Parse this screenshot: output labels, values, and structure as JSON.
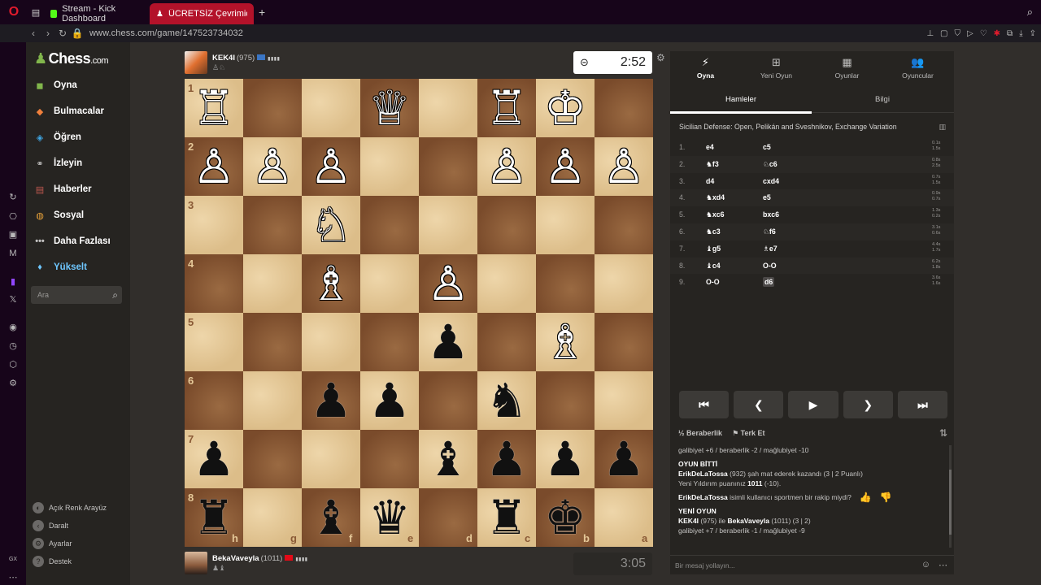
{
  "browser": {
    "tabs": [
      {
        "title": "Stream - Kick Dashboard",
        "favicon_color": "#53fc18"
      },
      {
        "title": "ÜCRETSİZ Çevrimiçi Satra",
        "favicon_color": "#81b64c"
      }
    ],
    "url": "www.chess.com/game/147523734032"
  },
  "sidebar": {
    "brand": "Chess",
    "brand_suffix": ".com",
    "items": [
      {
        "label": "Oyna",
        "icon": "play-icon",
        "color": "#81b64c"
      },
      {
        "label": "Bulmacalar",
        "icon": "puzzle-icon",
        "color": "#f0803c"
      },
      {
        "label": "Öğren",
        "icon": "learn-icon",
        "color": "#3fa6e3"
      },
      {
        "label": "İzleyin",
        "icon": "binoculars-icon",
        "color": "#c4c3c2"
      },
      {
        "label": "Haberler",
        "icon": "news-icon",
        "color": "#c0584f"
      },
      {
        "label": "Sosyal",
        "icon": "social-icon",
        "color": "#e8a23a"
      },
      {
        "label": "Daha Fazlası",
        "icon": "more-icon",
        "color": "#c4c3c2"
      },
      {
        "label": "Yükselt",
        "icon": "diamond-icon",
        "color": "#6ec7ff"
      }
    ],
    "search_placeholder": "Ara",
    "bottom": [
      {
        "label": "Açık Renk Arayüz",
        "icon": "theme-icon"
      },
      {
        "label": "Daralt",
        "icon": "collapse-icon"
      },
      {
        "label": "Ayarlar",
        "icon": "settings-icon"
      },
      {
        "label": "Destek",
        "icon": "help-icon"
      }
    ]
  },
  "players": {
    "top": {
      "name": "KEK4I",
      "rating": "(975)",
      "clock": "2:52",
      "flag_color": "#3a75c4"
    },
    "bottom": {
      "name": "BekaVaveyla",
      "rating": "(1011)",
      "clock": "3:05",
      "flag_color": "#e30a17"
    }
  },
  "board": {
    "files_bottom": [
      "h",
      "g",
      "f",
      "e",
      "d",
      "c",
      "b",
      "a"
    ],
    "ranks_left": [
      "1",
      "2",
      "3",
      "4",
      "5",
      "6",
      "7",
      "8"
    ],
    "pieces": [
      {
        "sq": "b1",
        "p": "♔",
        "c": "w"
      },
      {
        "sq": "c1",
        "p": "♖",
        "c": "w"
      },
      {
        "sq": "e1",
        "p": "♕",
        "c": "w"
      },
      {
        "sq": "h1",
        "p": "♖",
        "c": "w"
      },
      {
        "sq": "a2",
        "p": "♙",
        "c": "w"
      },
      {
        "sq": "b2",
        "p": "♙",
        "c": "w"
      },
      {
        "sq": "c2",
        "p": "♙",
        "c": "w"
      },
      {
        "sq": "f2",
        "p": "♙",
        "c": "w"
      },
      {
        "sq": "g2",
        "p": "♙",
        "c": "w"
      },
      {
        "sq": "h2",
        "p": "♙",
        "c": "w"
      },
      {
        "sq": "f3",
        "p": "♘",
        "c": "w"
      },
      {
        "sq": "d4",
        "p": "♙",
        "c": "w"
      },
      {
        "sq": "f4",
        "p": "♗",
        "c": "w"
      },
      {
        "sq": "b5",
        "p": "♗",
        "c": "w"
      },
      {
        "sq": "d5",
        "p": "♟",
        "c": "b"
      },
      {
        "sq": "c6",
        "p": "♞",
        "c": "b"
      },
      {
        "sq": "e6",
        "p": "♟",
        "c": "b"
      },
      {
        "sq": "f6",
        "p": "♟",
        "c": "b"
      },
      {
        "sq": "a7",
        "p": "♟",
        "c": "b"
      },
      {
        "sq": "b7",
        "p": "♟",
        "c": "b"
      },
      {
        "sq": "c7",
        "p": "♟",
        "c": "b"
      },
      {
        "sq": "d7",
        "p": "♝",
        "c": "b"
      },
      {
        "sq": "h7",
        "p": "♟",
        "c": "b"
      },
      {
        "sq": "b8",
        "p": "♚",
        "c": "b"
      },
      {
        "sq": "c8",
        "p": "♜",
        "c": "b"
      },
      {
        "sq": "e8",
        "p": "♛",
        "c": "b"
      },
      {
        "sq": "f8",
        "p": "♝",
        "c": "b"
      },
      {
        "sq": "h8",
        "p": "♜",
        "c": "b"
      }
    ]
  },
  "panel": {
    "tabs": [
      {
        "label": "Oyna",
        "icon": "bolt-icon",
        "glyph": "⚡"
      },
      {
        "label": "Yeni Oyun",
        "icon": "plus-icon",
        "glyph": "⊞"
      },
      {
        "label": "Oyunlar",
        "icon": "board-icon",
        "glyph": "▦"
      },
      {
        "label": "Oyuncular",
        "icon": "players-icon",
        "glyph": "👥"
      }
    ],
    "subtabs": [
      "Hamleler",
      "Bilgi"
    ],
    "opening": "Sicilian Defense: Open, Pelikán and Sveshnikov, Exchange Variation",
    "moves": [
      {
        "n": "1.",
        "w": "e4",
        "b": "c5",
        "tw": "0.1s",
        "tb": "1.5s"
      },
      {
        "n": "2.",
        "w": "♞f3",
        "b": "♘c6",
        "tw": "0.8s",
        "tb": "2.5s"
      },
      {
        "n": "3.",
        "w": "d4",
        "b": "cxd4",
        "tw": "0.7s",
        "tb": "1.5s"
      },
      {
        "n": "4.",
        "w": "♞xd4",
        "b": "e5",
        "tw": "0.9s",
        "tb": "0.7s"
      },
      {
        "n": "5.",
        "w": "♞xc6",
        "b": "bxc6",
        "tw": "1.3s",
        "tb": "0.2s"
      },
      {
        "n": "6.",
        "w": "♞c3",
        "b": "♘f6",
        "tw": "3.1s",
        "tb": "0.6s"
      },
      {
        "n": "7.",
        "w": "♝g5",
        "b": "♗e7",
        "tw": "4.4s",
        "tb": "1.7s"
      },
      {
        "n": "8.",
        "w": "♝c4",
        "b": "O-O",
        "tw": "6.2s",
        "tb": "1.8s"
      },
      {
        "n": "9.",
        "w": "O-O",
        "b": "d6",
        "tw": "3.6s",
        "tb": "1.6s"
      }
    ],
    "controls": [
      "⏮",
      "❮",
      "▶",
      "❯",
      "⏭"
    ],
    "draw_label": "Beraberlik",
    "draw_prefix": "½",
    "resign_label": "Terk Et",
    "chat": {
      "line0": "galibiyet +6 / beraberlik -2 / mağlubiyet -10",
      "end_title": "OYUN BİTTİ",
      "end_winner": "ErikDeLaTossa",
      "end_text": " (932) şah mat ederek kazandı (3 | 2 Puanlı)",
      "rating_prefix": "Yeni Yıldırım puanınız ",
      "rating_value": "1011",
      "rating_suffix": " (-10).",
      "question_name": "ErikDeLaTossa",
      "question_text": " isimli kullanıcı sportmen bir rakip miydi?",
      "new_title": "YENİ OYUN",
      "new_p1": "KEK4I",
      "new_mid": " (975) ile ",
      "new_p2": "BekaVaveyla",
      "new_tail": " (1011) (3 | 2)",
      "line_last": "galibiyet +7 / beraberlik -1 / mağlubiyet -9"
    },
    "chat_placeholder": "Bir mesaj yollayın..."
  }
}
